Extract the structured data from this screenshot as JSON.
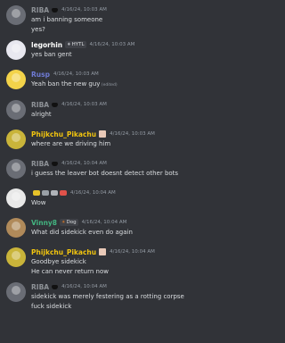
{
  "messages": [
    {
      "user": "RIBA",
      "user_color": "#8e9297",
      "badge_icon": "black-cat-icon",
      "time": "4/16/24, 10:03 AM",
      "lines": [
        "am i banning someone",
        "yes?"
      ],
      "avatar": "#6a6d75"
    },
    {
      "user": "legorhin",
      "user_color": "#ffffff",
      "tag": "HYTL",
      "tag_icon": "diamond-icon",
      "time": "4/16/24, 10:03 AM",
      "lines": [
        "yes ban gent"
      ],
      "avatar": "#e8e8f0"
    },
    {
      "user": "Rusp",
      "user_color": "#6f7bd6",
      "time": "4/16/24, 10:03 AM",
      "lines": [
        "Yeah ban the new guy"
      ],
      "edited": "(edited)",
      "avatar": "#f3d34a"
    },
    {
      "user": "RIBA",
      "user_color": "#8e9297",
      "badge_icon": "black-cat-icon",
      "time": "4/16/24, 10:03 AM",
      "lines": [
        "alright"
      ],
      "avatar": "#6a6d75"
    },
    {
      "user": "Phijkchu_Pikachu",
      "user_color": "#f1c40f",
      "badge_icon": "sticker-badge-icon",
      "time": "4/16/24, 10:03 AM",
      "lines": [
        "where are we driving him"
      ],
      "avatar": "#c9b43a"
    },
    {
      "user": "RIBA",
      "user_color": "#8e9297",
      "badge_icon": "black-cat-icon",
      "time": "4/16/24, 10:04 AM",
      "lines": [
        "i guess the leaver bot doesnt detect other bots"
      ],
      "avatar": "#6a6d75"
    },
    {
      "user": "",
      "user_color": "#f1c40f",
      "badge_icon": "emoji-name-icon",
      "time": "4/16/24, 10:04 AM",
      "lines": [
        "Wow"
      ],
      "avatar": "#e8e8e8"
    },
    {
      "user": "Vinny8",
      "user_color": "#43b581",
      "tag": "Dog",
      "tag_icon": "paw-icon",
      "time": "4/16/24, 10:04 AM",
      "lines": [
        "What did sidekick even do again"
      ],
      "avatar": "#b08a5a"
    },
    {
      "user": "Phijkchu_Pikachu",
      "user_color": "#f1c40f",
      "badge_icon": "sticker-badge-icon",
      "time": "4/16/24, 10:04 AM",
      "lines": [
        "Goodbye sidekick",
        "He can never return now"
      ],
      "avatar": "#c9b43a"
    },
    {
      "user": "RIBA",
      "user_color": "#8e9297",
      "badge_icon": "black-cat-icon",
      "time": "4/16/24, 10:04 AM",
      "lines": [
        "sidekick was merely festering as a rotting corpse",
        "fuck sidekick"
      ],
      "avatar": "#6a6d75"
    }
  ]
}
